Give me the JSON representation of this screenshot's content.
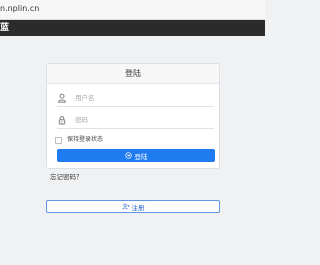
{
  "browser": {
    "url": "n.nplin.cn"
  },
  "navbar": {
    "brand": "蓝"
  },
  "login_panel": {
    "title": "登陆",
    "username": {
      "placeholder": "用户名",
      "value": "",
      "icon": "user-icon"
    },
    "password": {
      "placeholder": "密码",
      "value": "",
      "icon": "lock-icon"
    },
    "remember_label": "保持登录状态",
    "remember_checked": false,
    "login_button": {
      "label": "登陆",
      "icon": "sign-in-icon"
    }
  },
  "forgot_link": "忘记密码？",
  "register_button": {
    "label": "注册",
    "icon": "add-user-icon"
  },
  "colors": {
    "primary": "#1f7cf0",
    "navbar": "#2b2b2b",
    "background": "#f0f1f3",
    "register_border": "#5f94de"
  }
}
